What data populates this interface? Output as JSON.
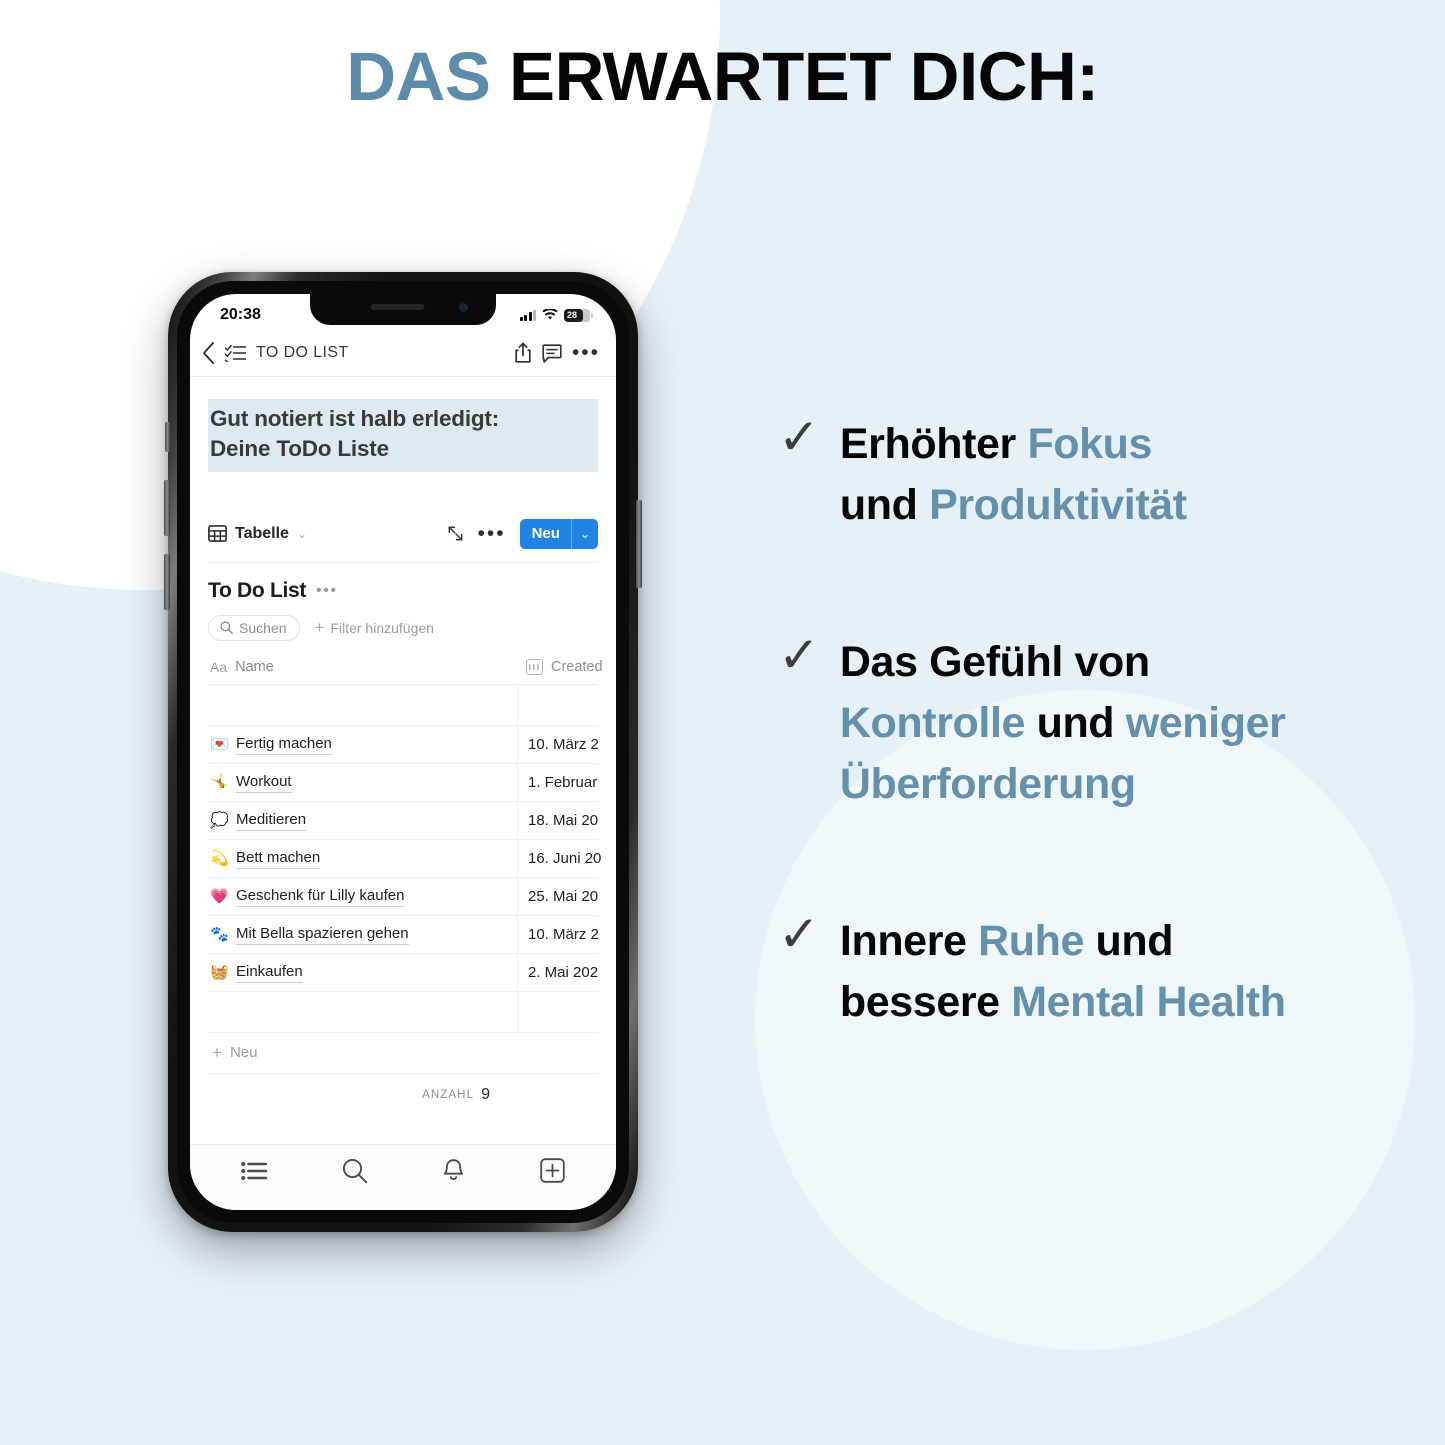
{
  "headline": {
    "accent_word": "DAS",
    "rest": " ERWARTET DICH:"
  },
  "theme": {
    "page_background": "#e5f0f7",
    "accent_blue": "#6490ac",
    "title_accent": "#5d8cab",
    "notion_blue": "#2383e2",
    "heading_highlight": "#ddeaf2"
  },
  "phone": {
    "status_bar": {
      "time": "20:38",
      "signal_icon": "cellular-signal-icon",
      "wifi_icon": "wifi-icon",
      "battery_percent": "28",
      "battery_icon": "battery-icon"
    },
    "app_header": {
      "back_icon": "chevron-left-icon",
      "page_icon": "checklist-icon",
      "title": "TO DO LIST",
      "share_icon": "share-icon",
      "comment_icon": "comment-icon",
      "more_icon": "more-horizontal-icon"
    },
    "page_title": {
      "line1": "Gut notiert ist halb erledigt:",
      "line2": "Deine ToDo Liste"
    },
    "db_toolbar": {
      "view_icon": "table-icon",
      "view_label": "Tabelle",
      "view_chevron": "chevron-down-icon",
      "expand_icon": "expand-arrows-icon",
      "more_icon": "more-horizontal-icon",
      "new_label": "Neu",
      "new_chevron": "chevron-down-icon"
    },
    "database": {
      "title": "To Do List",
      "title_more_icon": "more-horizontal-icon",
      "search_icon": "search-icon",
      "search_placeholder": "Suchen",
      "add_filter_label": "Filter hinzufügen",
      "columns": [
        {
          "icon": "text-type-icon",
          "icon_glyph": "Aa",
          "label": "Name"
        },
        {
          "icon": "calendar-icon",
          "icon_glyph": "",
          "label": "Created"
        }
      ],
      "rows": [
        {
          "emoji": "💌",
          "emoji_name": "love-letter-emoji",
          "name": "Fertig machen",
          "created": "10. März 2"
        },
        {
          "emoji": "🤸",
          "emoji_name": "cartwheel-emoji",
          "name": "Workout",
          "created": "1. Februar"
        },
        {
          "emoji": "💭",
          "emoji_name": "thought-balloon-emoji",
          "name": "Meditieren",
          "created": "18. Mai 20"
        },
        {
          "emoji": "💫",
          "emoji_name": "dizzy-emoji",
          "name": "Bett machen",
          "created": "16. Juni 20"
        },
        {
          "emoji": "💗",
          "emoji_name": "growing-heart-emoji",
          "name": "Geschenk für Lilly kaufen",
          "created": "25. Mai 20"
        },
        {
          "emoji": "🐾",
          "emoji_name": "paw-prints-emoji",
          "name": "Mit Bella spazieren gehen",
          "created": "10. März 2"
        },
        {
          "emoji": "🧺",
          "emoji_name": "basket-emoji",
          "name": "Einkaufen",
          "created": "2. Mai 202"
        }
      ],
      "new_row_label": "Neu",
      "count_label": "ANZAHL",
      "count_value": "9"
    },
    "bottom_nav": [
      {
        "name": "list-icon"
      },
      {
        "name": "search-icon"
      },
      {
        "name": "bell-icon"
      },
      {
        "name": "plus-box-icon"
      }
    ]
  },
  "bullets": [
    {
      "check_glyph": "✓",
      "segments": [
        {
          "text": "Erhöhter ",
          "accent": false
        },
        {
          "text": "Fokus",
          "accent": true
        },
        {
          "text": "\nund ",
          "accent": false
        },
        {
          "text": "Produktivität",
          "accent": true
        }
      ],
      "line1_plain": "Erhöhter ",
      "line1_accent": "Fokus",
      "line2_plain": "und ",
      "line2_accent": "Produktivität"
    },
    {
      "check_glyph": "✓",
      "line1_plain": "Das Gefühl von",
      "line1_accent": "",
      "line2_accent_a": "Kontrolle",
      "line2_plain": " und ",
      "line2_accent_b": "weniger",
      "line3_accent": "Überforderung"
    },
    {
      "check_glyph": "✓",
      "line1_plain_a": "Innere ",
      "line1_accent": "Ruhe",
      "line1_plain_b": " und",
      "line2_plain": "bessere ",
      "line2_accent": "Mental Health"
    }
  ]
}
